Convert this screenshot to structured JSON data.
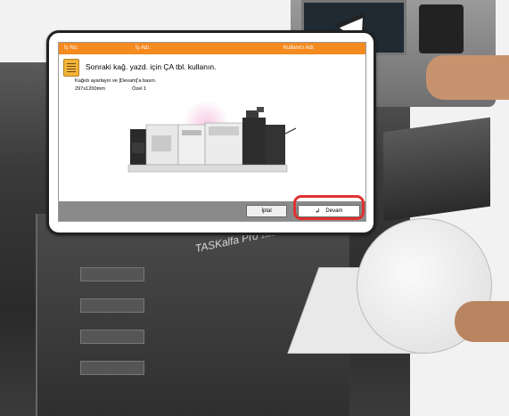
{
  "header": {
    "job_no_label": "İş No:",
    "job_name_label": "İş Adı:",
    "user_name_label": "Kullanıcı Adı:"
  },
  "message": {
    "title": "Sonraki kağ. yazd. için ÇA tbl. kullanın.",
    "instruction": "Kağıdı ayarlayın ve [Devam]'a basın.",
    "paper_size": "297x1200mm",
    "paper_type": "Özel 1"
  },
  "buttons": {
    "cancel_label": "İptal",
    "continue_label": "Devam"
  },
  "device": {
    "brand_label": "TASKalfa Pro",
    "brand_sub": "15000c"
  },
  "colors": {
    "header_bar": "#f58a1f",
    "highlight_ring": "#e03030",
    "bottom_bar": "#8a8a8a"
  },
  "icons": {
    "message": "message-list-icon",
    "continue": "enter-arrow-icon"
  }
}
